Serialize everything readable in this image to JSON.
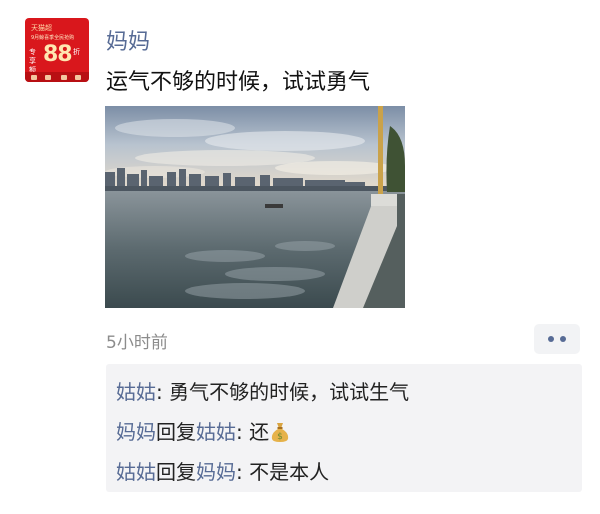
{
  "post": {
    "author": "妈妈",
    "text": "运气不够的时候，试试勇气",
    "time": "5小时前"
  },
  "avatar": {
    "brand": "天猫超",
    "promo_line": "9月鲸喜季全民抢购",
    "left_tag": "专享额外",
    "number": "88",
    "right_tag": "折",
    "bg_color": "#d9171c"
  },
  "comments": [
    {
      "author": "姑姑",
      "separator": ": ",
      "text": "勇气不够的时候，试试生气"
    },
    {
      "author": "妈妈",
      "reply_word": "回复",
      "reply_to": "姑姑",
      "separator": ": ",
      "text": "还",
      "emoji": "money-bag-icon"
    },
    {
      "author": "姑姑",
      "reply_word": "回复",
      "reply_to": "妈妈",
      "separator": ": ",
      "text": "不是本人"
    }
  ],
  "colors": {
    "link_name": "#576b95",
    "text": "#111111",
    "muted": "#8c8c8c",
    "comment_bg": "#f3f3f5"
  }
}
